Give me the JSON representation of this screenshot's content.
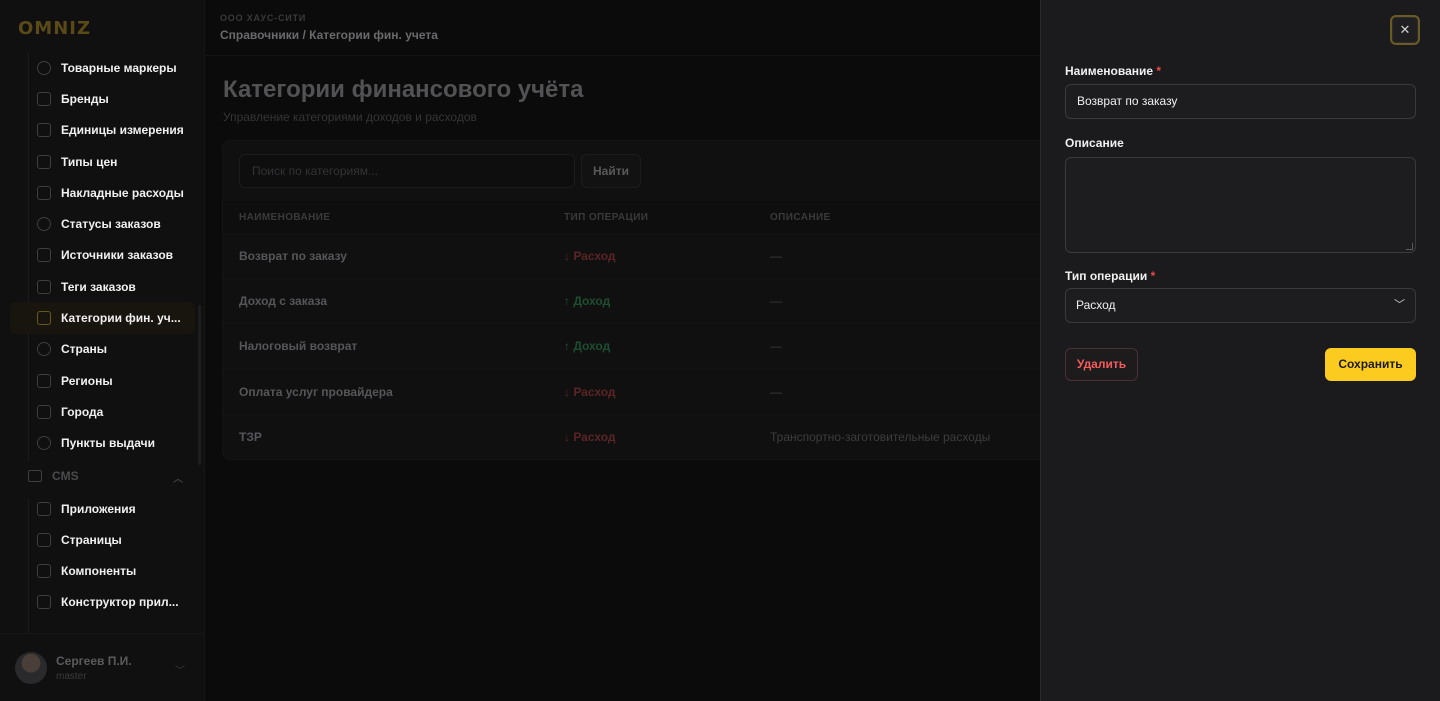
{
  "brand": {
    "logo_text": "OMNIZ"
  },
  "sidebar": {
    "items": [
      {
        "label": "Товарные маркеры",
        "icon": "circle-icon"
      },
      {
        "label": "Бренды",
        "icon": "bookmark-icon"
      },
      {
        "label": "Единицы измерения",
        "icon": "ruler-icon"
      },
      {
        "label": "Типы цен",
        "icon": "banknote-icon"
      },
      {
        "label": "Накладные расходы",
        "icon": "receipt-icon"
      },
      {
        "label": "Статусы заказов",
        "icon": "route-icon"
      },
      {
        "label": "Источники заказов",
        "icon": "signpost-icon"
      },
      {
        "label": "Теги заказов",
        "icon": "tag-icon"
      },
      {
        "label": "Категории фин. уч...",
        "icon": "wallet-icon",
        "active": true
      },
      {
        "label": "Страны",
        "icon": "globe-icon"
      },
      {
        "label": "Регионы",
        "icon": "map-icon"
      },
      {
        "label": "Города",
        "icon": "building-icon"
      },
      {
        "label": "Пункты выдачи",
        "icon": "map-pin-icon"
      }
    ],
    "section": {
      "label": "CMS",
      "icon": "browser-icon"
    },
    "cms_items": [
      {
        "label": "Приложения",
        "icon": "sparkles-icon"
      },
      {
        "label": "Страницы",
        "icon": "book-open-icon"
      },
      {
        "label": "Компоненты",
        "icon": "components-icon"
      },
      {
        "label": "Конструктор прил...",
        "icon": "wand-icon"
      }
    ]
  },
  "user": {
    "name": "Сергеев П.И.",
    "role": "master"
  },
  "header": {
    "org": "ООО ХАУС-СИТИ",
    "breadcrumb": "Справочники / Категории фин. учета"
  },
  "page": {
    "title": "Категории финансового учёта",
    "subtitle": "Управление категориями доходов и расходов"
  },
  "search": {
    "placeholder": "Поиск по категориям...",
    "button": "Найти"
  },
  "table": {
    "columns": [
      "НАИМЕНОВАНИЕ",
      "ТИП ОПЕРАЦИИ",
      "ОПИСАНИЕ"
    ],
    "rows": [
      {
        "name": "Возврат по заказу",
        "type": "↓ Расход",
        "kind": "expense",
        "description": "—"
      },
      {
        "name": "Доход с заказа",
        "type": "↑ Доход",
        "kind": "income",
        "description": "—"
      },
      {
        "name": "Налоговый возврат",
        "type": "↑ Доход",
        "kind": "income",
        "description": "—"
      },
      {
        "name": "Оплата услуг провайдера",
        "type": "↓ Расход",
        "kind": "expense",
        "description": "—"
      },
      {
        "name": "ТЗР",
        "type": "↓ Расход",
        "kind": "expense",
        "description": "Транспортно-заготовительные расходы"
      }
    ]
  },
  "drawer": {
    "close": "✕",
    "name_label": "Наименование",
    "name_value": "Возврат по заказу",
    "description_label": "Описание",
    "description_value": "",
    "type_label": "Тип операции",
    "type_value": "Расход",
    "required_mark": "*",
    "delete_button": "Удалить",
    "save_button": "Сохранить"
  },
  "colors": {
    "accent": "#fbcc1f",
    "danger": "#f25c5c",
    "expense": "#ef4444",
    "income": "#22c55e",
    "drawer_bg": "#1b1b1d"
  }
}
